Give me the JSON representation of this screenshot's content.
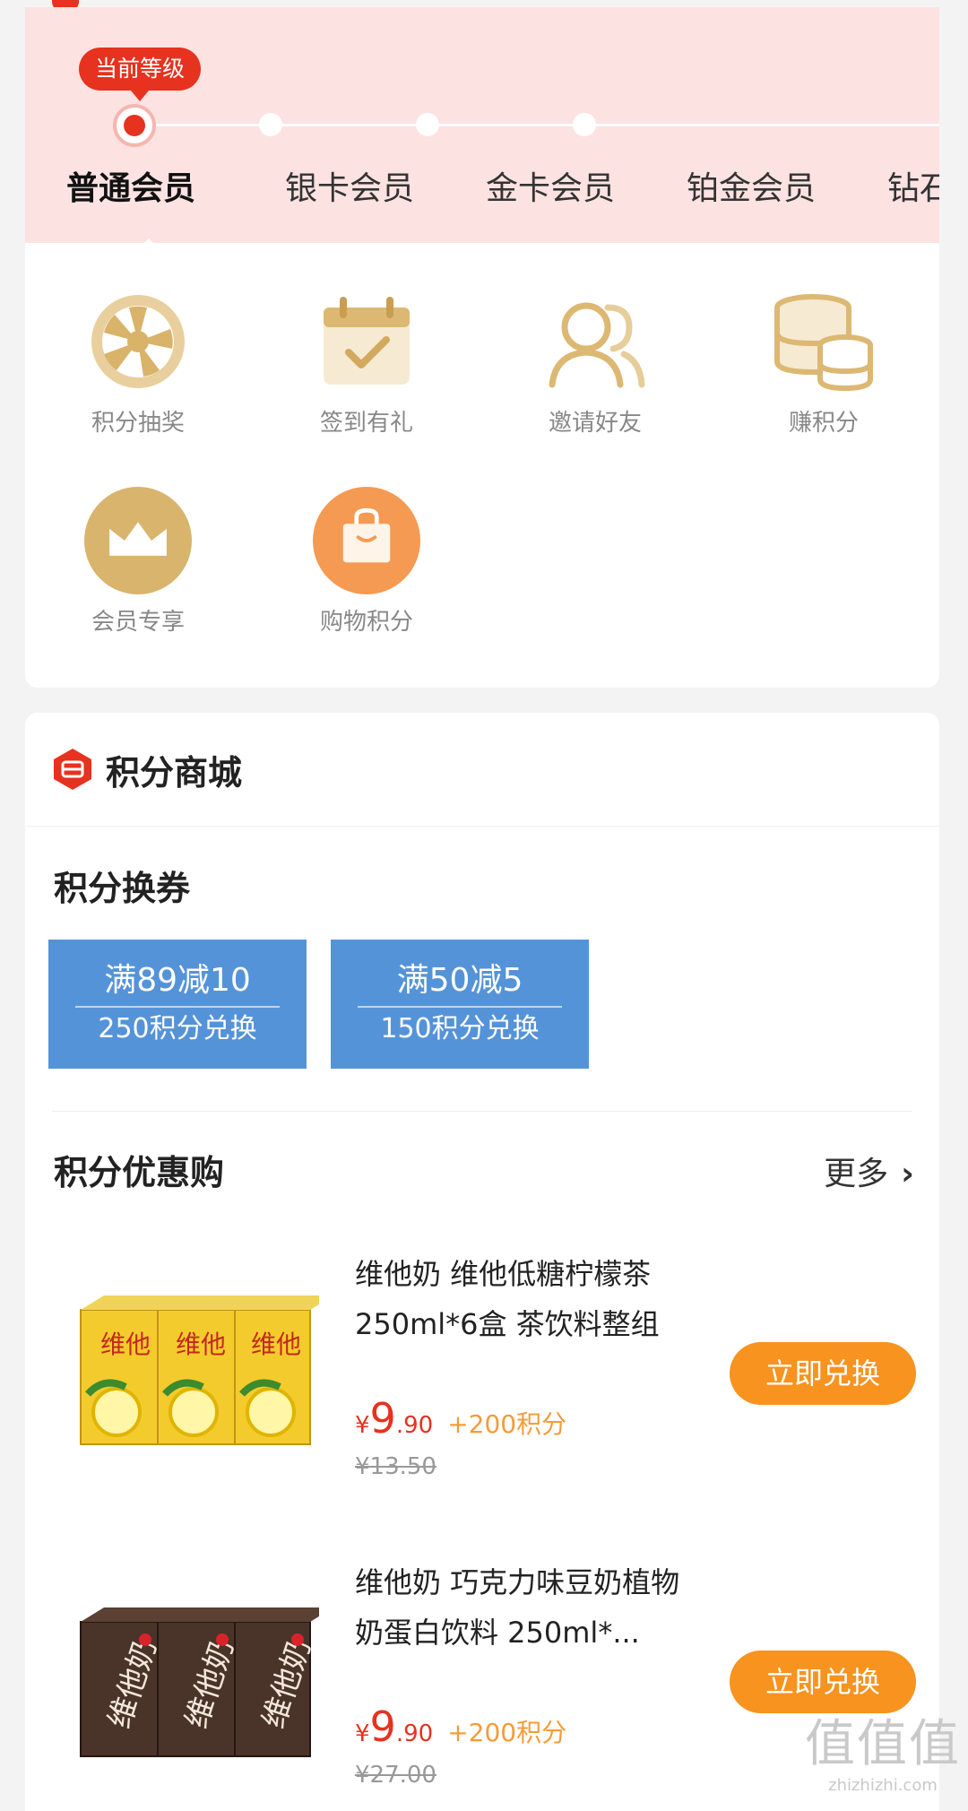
{
  "levels": {
    "current_badge": "当前等级",
    "items": [
      "普通会员",
      "银卡会员",
      "金卡会员",
      "铂金会员",
      "钻石"
    ]
  },
  "features": [
    {
      "label": "积分抽奖",
      "icon": "lottery-wheel-icon"
    },
    {
      "label": "签到有礼",
      "icon": "calendar-check-icon"
    },
    {
      "label": "邀请好友",
      "icon": "users-icon"
    },
    {
      "label": "赚积分",
      "icon": "coins-stack-icon"
    },
    {
      "label": "会员专享",
      "icon": "crown-icon"
    },
    {
      "label": "购物积分",
      "icon": "shopping-bag-icon"
    }
  ],
  "mall": {
    "title": "积分商城",
    "coupon_section_title": "积分换券",
    "coupons": [
      {
        "title": "满89减10",
        "cost": "250积分兑换"
      },
      {
        "title": "满50减5",
        "cost": "150积分兑换"
      }
    ],
    "deals_title": "积分优惠购",
    "more_label": "更多",
    "products": [
      {
        "name": "维他奶 维他低糖柠檬茶250ml*6盒 茶饮料整组",
        "yen": "¥",
        "price_int": "9",
        "price_dec": ".90",
        "points": "+200积分",
        "old_price": "¥13.50",
        "button": "立即兑换"
      },
      {
        "name": "维他奶 巧克力味豆奶植物奶蛋白饮料 250ml*...",
        "yen": "¥",
        "price_int": "9",
        "price_dec": ".90",
        "points": "+200积分",
        "old_price": "¥27.00",
        "button": "立即兑换"
      }
    ]
  },
  "watermark": {
    "logo": "值值值",
    "url": "zhizhizhi.com"
  },
  "colors": {
    "accent": "#e6321e",
    "orange": "#f7931e",
    "coupon": "#5593d8",
    "gold": "#d9b36a"
  }
}
